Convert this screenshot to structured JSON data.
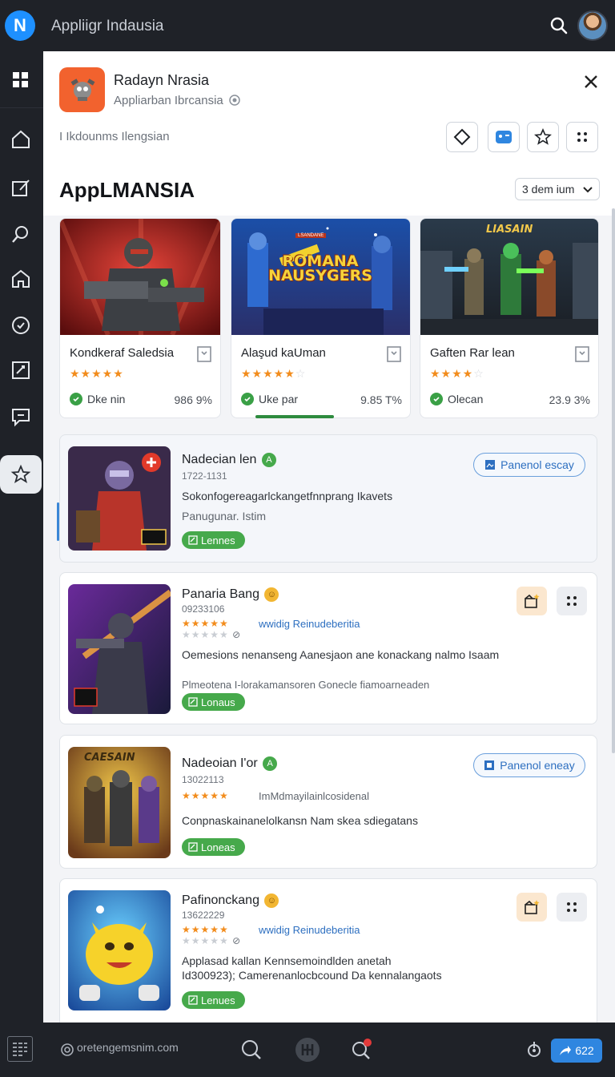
{
  "app": {
    "logo_letter": "N",
    "title": "Appliigr Indausia"
  },
  "panel": {
    "app_name": "Radayn Nrasia",
    "app_subtitle": "Appliarban Ibrcansia",
    "breadcrumb": "I Ikdounms Ilengsian",
    "section_title": "AppLMANSIA",
    "sort_label": "3 dem ium"
  },
  "featured": [
    {
      "name": "Kondkeraf Saledsia",
      "stars": 5,
      "status": "Dke nin",
      "percent": "986 9%"
    },
    {
      "name": "Alaşud kaUman",
      "stars": 5,
      "status": "Uke par",
      "percent": "9.85 T%",
      "art_title": "ROMANA NAUSYGERS",
      "art_top": "LSANDANE"
    },
    {
      "name": "Gaften Rar lean",
      "stars": 4,
      "status": "Olecan",
      "percent": "23.9 3%",
      "art_title": "LIASAIN"
    }
  ],
  "list": [
    {
      "name": "Nadecian len",
      "badge": "A",
      "id": "1722-1131",
      "text": "Sokonfogereagarlckangetfnnprang Ikavets",
      "sub": "Panugunar. Istim",
      "pill": "Lennes",
      "action": "Panenol escay"
    },
    {
      "name": "Panaria Bang",
      "id": "09233106",
      "rating_link": "wwidig Reinudeberitia",
      "text": "Oemesions nenanseng Aanesjaon ane konackang nalmo Isaam",
      "sub": "Plmeotena I-lorakamansoren Gonecle fiamoarneaden",
      "pill": "Lonaus"
    },
    {
      "name": "Nadeoian I'or",
      "badge": "A",
      "id": "13022113",
      "rating_text": "ImMdmayilainlcosidenal",
      "text": "Conpnaskainanelolkansn Nam skea sdiegatans",
      "pill": "Loneas",
      "action": "Panenol eneay",
      "art_title": "CAESAIN"
    },
    {
      "name": "Pafinonckang",
      "id": "13622229",
      "rating_link": "wwidig Reinudeberitia",
      "text": "Applasad kallan Kennsemoindlden anetah",
      "text2": "Id300923); Camerenanlocbcound Da kennalangaots",
      "pill": "Lenues"
    }
  ],
  "bottom": {
    "url": "oretengemsnim.com",
    "count": "622"
  },
  "colors": {
    "accent": "#2f86e0",
    "green": "#46a94b",
    "star": "#f28c1c"
  }
}
